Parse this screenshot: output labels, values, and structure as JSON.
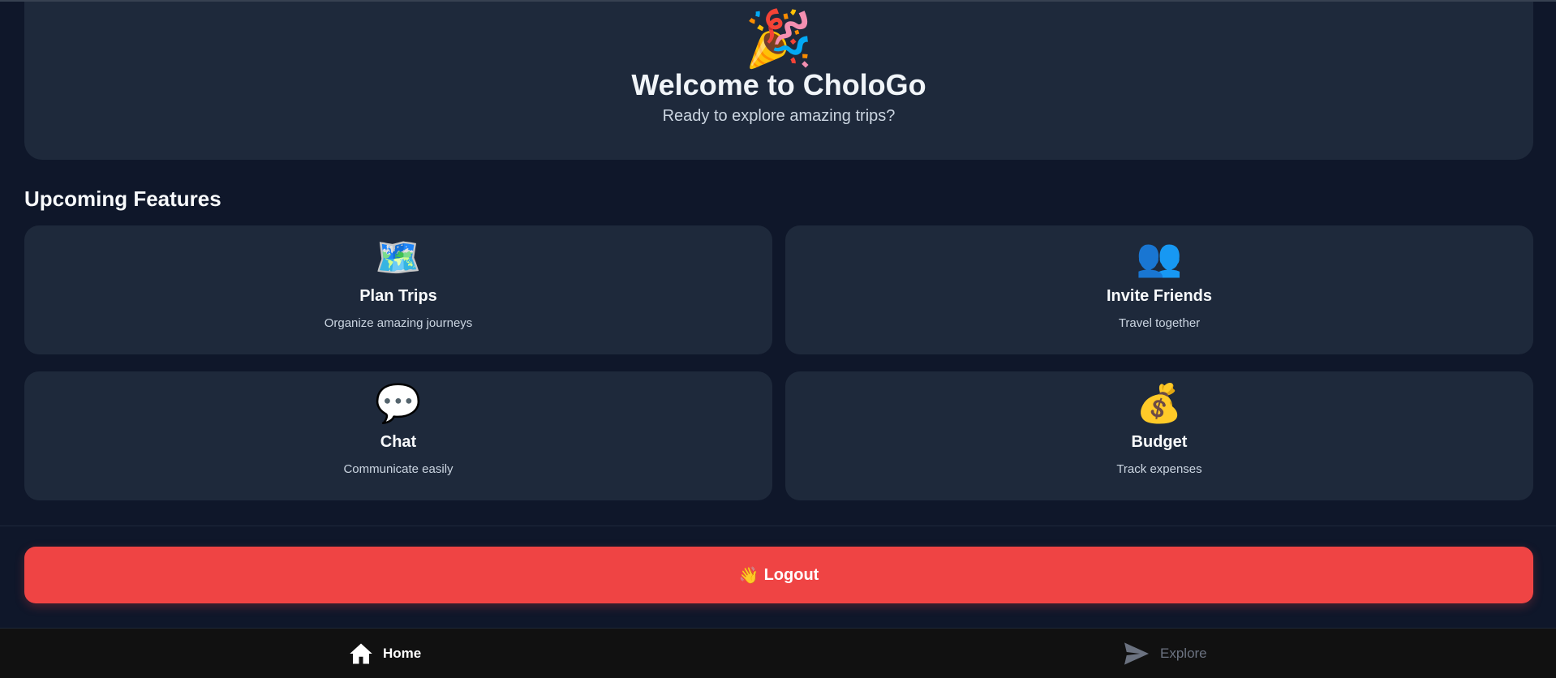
{
  "hero": {
    "emoji": "🎉",
    "title": "Welcome to CholoGo",
    "subtitle": "Ready to explore amazing trips?"
  },
  "features": {
    "section_title": "Upcoming Features",
    "items": [
      {
        "icon": "🗺️",
        "icon_name": "map-icon",
        "title": "Plan Trips",
        "description": "Organize amazing journeys"
      },
      {
        "icon": "👥",
        "icon_name": "friends-icon",
        "title": "Invite Friends",
        "description": "Travel together"
      },
      {
        "icon": "💬",
        "icon_name": "speech-bubble-icon",
        "title": "Chat",
        "description": "Communicate easily"
      },
      {
        "icon": "💰",
        "icon_name": "money-bag-icon",
        "title": "Budget",
        "description": "Track expenses"
      }
    ]
  },
  "logout": {
    "icon": "👋",
    "label": "Logout",
    "color": "#ef4444"
  },
  "bottom_nav": {
    "items": [
      {
        "label": "Home",
        "icon_name": "home-icon",
        "active": true
      },
      {
        "label": "Explore",
        "icon_name": "send-icon",
        "active": false
      }
    ]
  },
  "colors": {
    "background": "#0f172a",
    "card": "#1e293b",
    "nav_background": "#111111",
    "inactive": "#6b7280"
  }
}
